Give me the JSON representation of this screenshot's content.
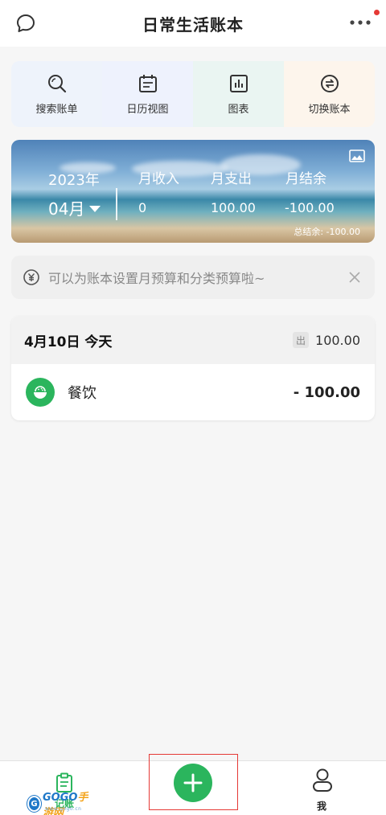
{
  "header": {
    "title": "日常生活账本",
    "left_icon": "chat-bubble-icon",
    "more_icon": "more-dots-icon"
  },
  "quick_actions": [
    {
      "label": "搜索账单",
      "icon": "search-icon"
    },
    {
      "label": "日历视图",
      "icon": "calendar-icon"
    },
    {
      "label": "图表",
      "icon": "chart-icon"
    },
    {
      "label": "切换账本",
      "icon": "switch-icon"
    }
  ],
  "summary": {
    "year": "2023年",
    "month": "04月",
    "income_label": "月收入",
    "income_value": "0",
    "expense_label": "月支出",
    "expense_value": "100.00",
    "balance_label": "月结余",
    "balance_value": "-100.00",
    "total_balance": "总结余: -100.00"
  },
  "tip": {
    "text": "可以为账本设置月预算和分类预算啦~",
    "icon": "yen-budget-icon"
  },
  "records": {
    "day_title": "4月10日 今天",
    "out_badge": "出",
    "day_total": "100.00",
    "items": [
      {
        "category": "餐饮",
        "amount": "- 100.00",
        "icon": "food-bowl-icon"
      }
    ]
  },
  "tabbar": {
    "left_label": "记账",
    "right_label": "我",
    "watermark_brand": "GOGO",
    "watermark_suffix": "手游网",
    "watermark_url": "www.gogo.cn",
    "add_icon": "plus-icon"
  },
  "colors": {
    "accent_green": "#2bb55d",
    "highlight_red": "#e53935"
  }
}
